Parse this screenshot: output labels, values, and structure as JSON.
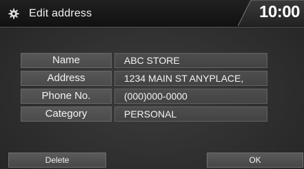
{
  "header": {
    "title": "Edit address",
    "icon": "gear-icon",
    "clock": "10:00"
  },
  "fields": [
    {
      "label": "Name",
      "value": "ABC STORE"
    },
    {
      "label": "Address",
      "value": "1234 MAIN ST ANYPLACE,"
    },
    {
      "label": "Phone No.",
      "value": "(000)000-0000"
    },
    {
      "label": "Category",
      "value": "PERSONAL"
    }
  ],
  "buttons": {
    "delete": "Delete",
    "ok": "OK"
  },
  "colors": {
    "background": "#333333",
    "titlebar": "#111111",
    "field": "#4c4c4c",
    "text": "#f4f4f4"
  }
}
